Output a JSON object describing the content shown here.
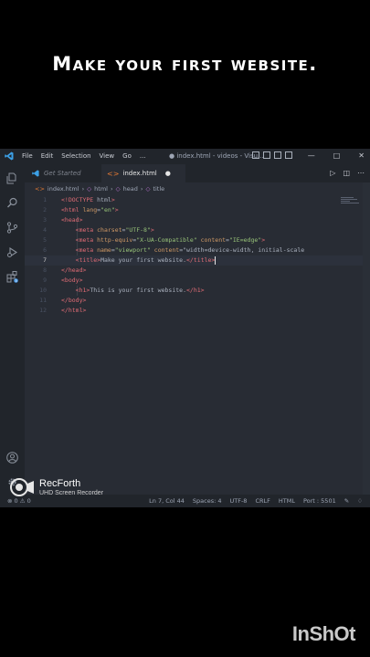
{
  "caption": "Make your first website.",
  "menu": [
    "File",
    "Edit",
    "Selection",
    "View",
    "Go",
    "..."
  ],
  "window_title": "● index.html - videos - Visu...",
  "tabs": {
    "inactive_label": "Get Started",
    "active_label": "index.html"
  },
  "breadcrumb": {
    "file": "index.html",
    "seg1": "html",
    "seg2": "head",
    "seg3": "title"
  },
  "code_lines": [
    {
      "n": "1",
      "t": "<!DOCTYPE html>"
    },
    {
      "n": "2",
      "t": "<html lang=\"en\">"
    },
    {
      "n": "3",
      "t": "<head>"
    },
    {
      "n": "4",
      "t": "    <meta charset=\"UTF-8\">"
    },
    {
      "n": "5",
      "t": "    <meta http-equiv=\"X-UA-Compatible\" content=\"IE=edge\">"
    },
    {
      "n": "6",
      "t": "    <meta name=\"viewport\" content=\"width=device-width, initial-scale"
    },
    {
      "n": "7",
      "t": "    <title>Make your first website.</title>"
    },
    {
      "n": "8",
      "t": "</head>"
    },
    {
      "n": "9",
      "t": "<body>"
    },
    {
      "n": "10",
      "t": "    <h1>This is your first website.</h1>"
    },
    {
      "n": "11",
      "t": "</body>"
    },
    {
      "n": "12",
      "t": "</html>"
    }
  ],
  "current_line": 7,
  "status": {
    "problems": "⊗ 0 ⚠ 0",
    "position": "Ln 7, Col 44",
    "spaces": "Spaces: 4",
    "encoding": "UTF-8",
    "eol": "CRLF",
    "language": "HTML",
    "port": "Port : 5501"
  },
  "badges": {
    "extensions": "3",
    "accounts": "1"
  },
  "recorder": {
    "name": "RecForth",
    "subtitle": "UHD Screen Recorder"
  },
  "watermark": "InShOt",
  "colors": {
    "tag": "#e06c75",
    "attr": "#d19a66",
    "string": "#98c379",
    "accent": "#4d9be6"
  }
}
